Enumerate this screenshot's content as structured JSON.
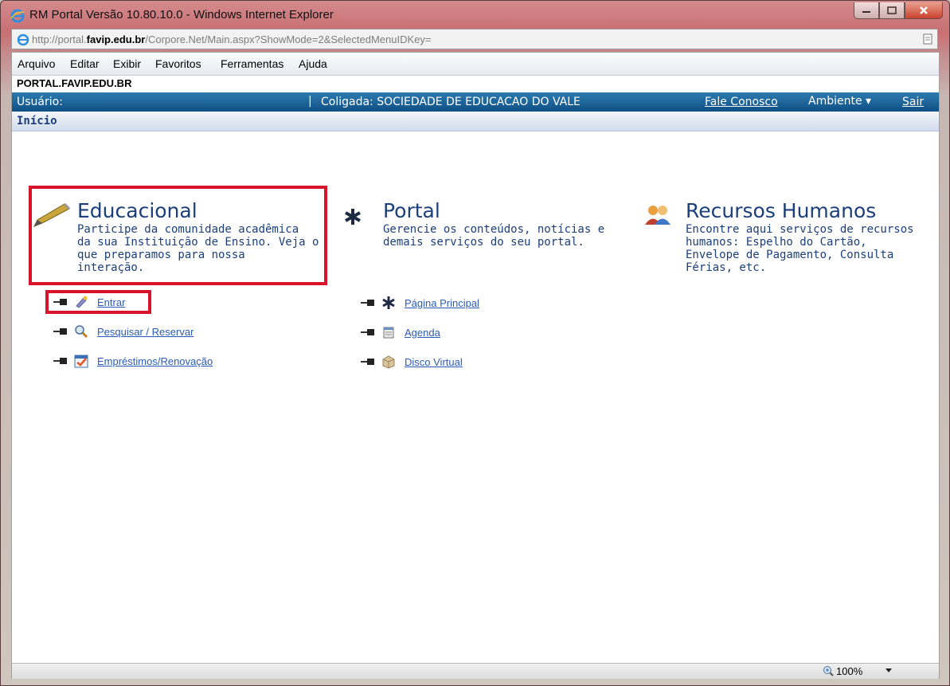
{
  "window": {
    "title": "RM Portal Versão 10.80.10.0 - Windows Internet Explorer"
  },
  "address": {
    "url_prefix": "http://portal.",
    "url_domain": "favip.edu.br",
    "url_suffix": "/Corpore.Net/Main.aspx?ShowMode=2&SelectedMenuIDKey="
  },
  "menu": {
    "items": [
      {
        "label": "Arquivo"
      },
      {
        "label": "Editar"
      },
      {
        "label": "Exibir"
      },
      {
        "label": "Favoritos"
      },
      {
        "label": "Ferramentas"
      },
      {
        "label": "Ajuda"
      }
    ]
  },
  "site": {
    "header": "PORTAL.FAVIP.EDU.BR"
  },
  "userbar": {
    "usuario": "Usuário:",
    "separator": "|",
    "coligada": "Coligada: SOCIEDADE DE EDUCACAO DO VALE",
    "fale": "Fale Conosco",
    "ambiente": "Ambiente ▾",
    "sair": "Sair"
  },
  "breadcrumb": {
    "label": "Início"
  },
  "sections": {
    "educacional": {
      "title": "Educacional",
      "desc": [
        "Participe da comunidade acadêmica",
        "da sua Instituição de Ensino. Veja o",
        "que preparamos para nossa",
        "interação."
      ],
      "links": [
        "Entrar",
        "Pesquisar / Reservar",
        "Empréstimos/Renovação"
      ]
    },
    "portal": {
      "title": "Portal",
      "desc": [
        "Gerencie os conteúdos, notícias e",
        "demais serviços do seu portal."
      ],
      "links": [
        "Página Principal",
        "Agenda",
        "Disco Virtual"
      ]
    },
    "rh": {
      "title": "Recursos Humanos",
      "desc": [
        "Encontre aqui serviços de recursos",
        "humanos: Espelho do Cartão,",
        "Envelope de Pagamento, Consulta",
        "Férias, etc."
      ]
    }
  },
  "status": {
    "zoom": "100%"
  },
  "colors": {
    "accent_blue": "#1b3f7b",
    "highlight_red": "#d9132a",
    "link": "#2a5bb8",
    "userbar_bg": "#0f4f84"
  }
}
